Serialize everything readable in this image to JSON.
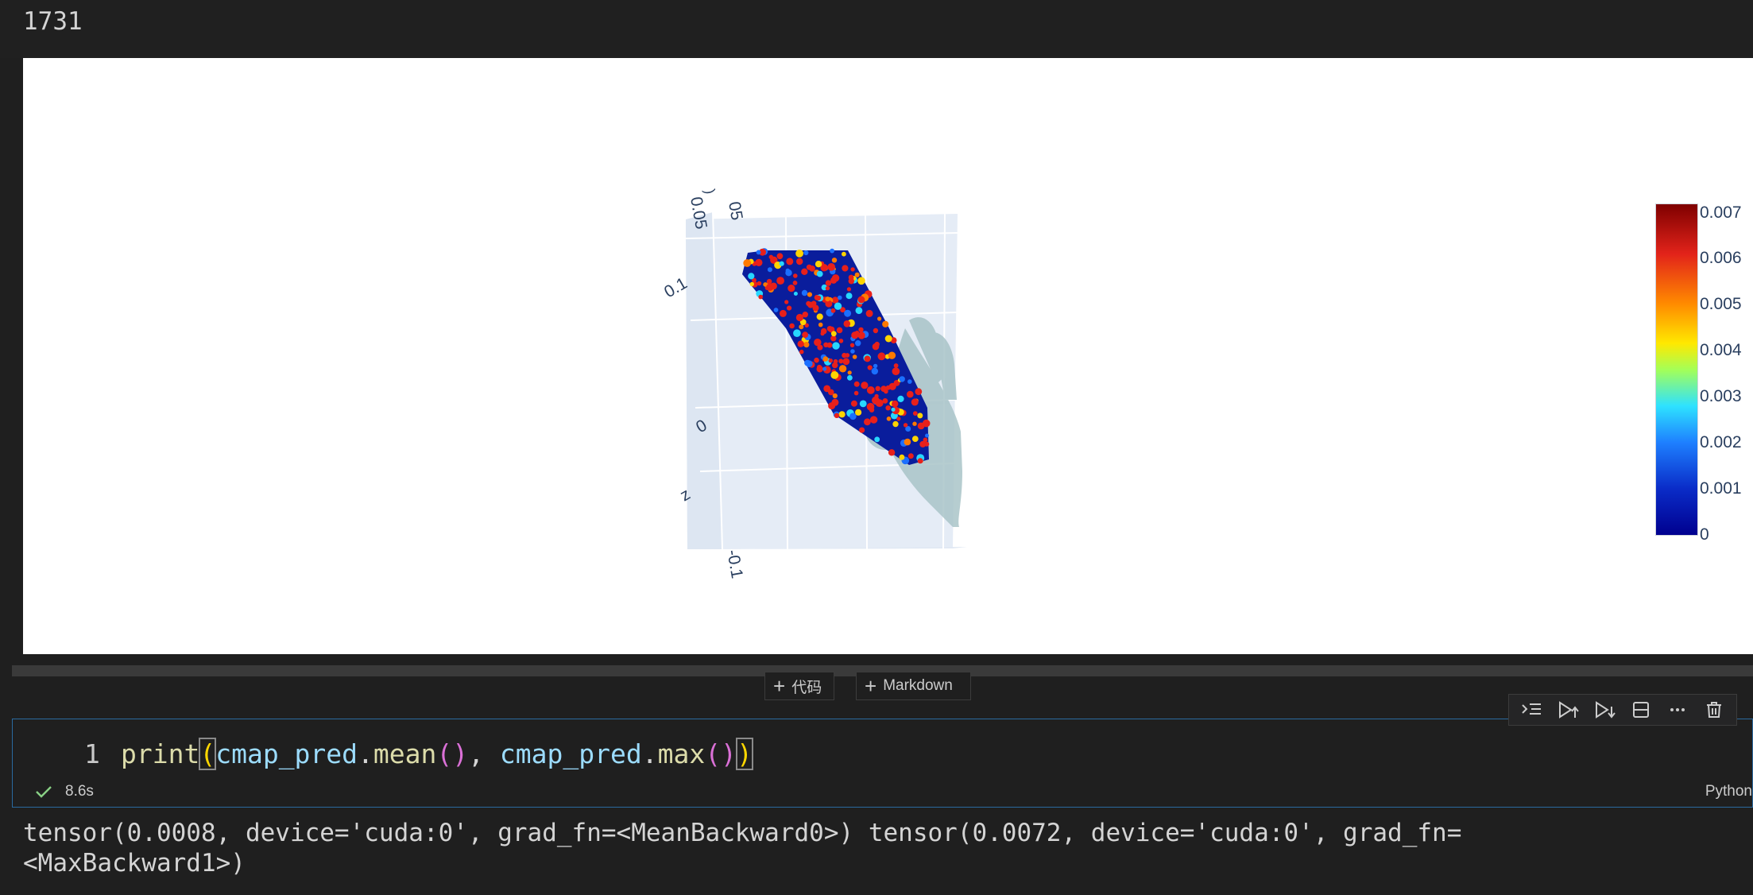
{
  "top_output": {
    "value": "1731"
  },
  "plot": {
    "axis_ticks": [
      "05",
      "0.05",
      ")",
      "0.1",
      "0",
      "z",
      "-0.1"
    ],
    "colors": {
      "point_base": "#0a1d9c",
      "hand": "#a9c4c8",
      "scene_bg": "#e5ecf6"
    },
    "colorbar": {
      "labels": [
        "0.007",
        "0.006",
        "0.005",
        "0.004",
        "0.003",
        "0.002",
        "0.001",
        "0"
      ],
      "min": 0,
      "max": 0.0075,
      "colorscale": "jet"
    }
  },
  "cell_add": {
    "code_label": "代码",
    "markdown_label": "Markdown"
  },
  "cell_toolbar": {
    "icons": [
      "run-by-line-icon",
      "run-above-icon",
      "run-below-icon",
      "split-cell-icon",
      "more-icon",
      "delete-icon"
    ]
  },
  "code_cell": {
    "line_number": "1",
    "code": {
      "fn": "print",
      "open": "(",
      "var1": "cmap_pred",
      "dot1": ".",
      "m1": "mean",
      "p1": "()",
      "comma": ", ",
      "var2": "cmap_pred",
      "dot2": ".",
      "m2": "max",
      "p2": "()",
      "close": ")"
    },
    "status": "8.6s",
    "language": "Python"
  },
  "output": {
    "line1": "tensor(0.0008, device='cuda:0', grad_fn=<MeanBackward0>) tensor(0.0072, device='cuda:0', grad_fn=",
    "line2": "<MaxBackward1>)"
  }
}
